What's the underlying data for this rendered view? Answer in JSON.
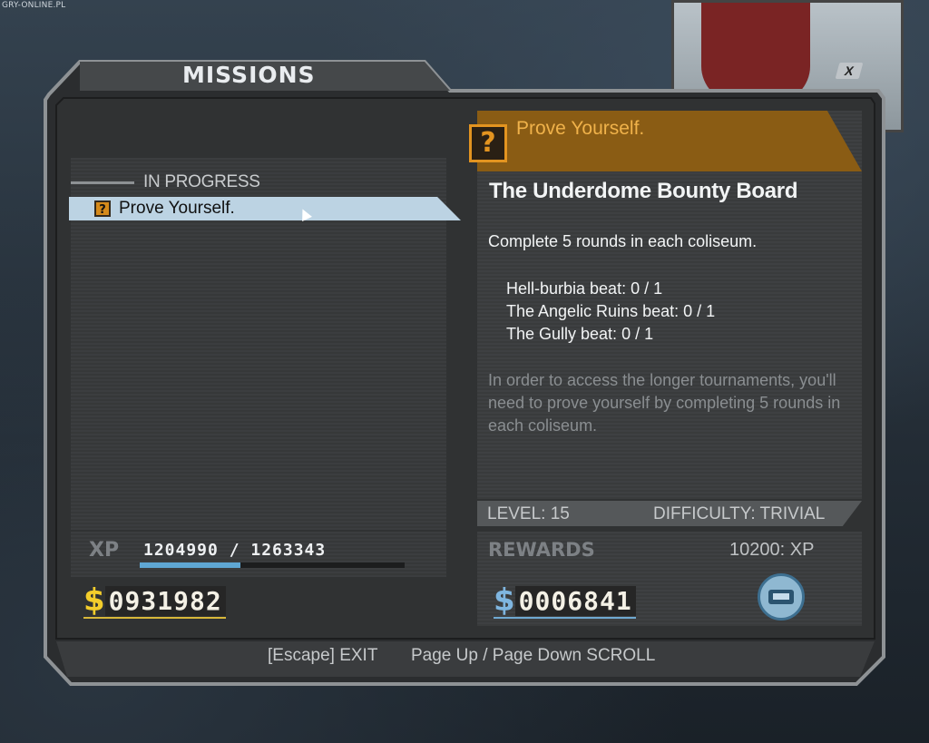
{
  "watermark": "GRY-ONLINE.PL",
  "window": {
    "title": "MISSIONS",
    "close_label": "X"
  },
  "mission_list": {
    "section_label": "IN PROGRESS",
    "items": [
      {
        "label": "Prove Yourself.",
        "icon": "mission-question-icon",
        "selected": true
      }
    ]
  },
  "player": {
    "xp_label": "XP",
    "xp_current": "1204990",
    "xp_separator": " / ",
    "xp_next": "1263343",
    "xp_progress": 0.38,
    "money_symbol": "$",
    "money": "0931982"
  },
  "detail": {
    "icon": "mission-question-icon",
    "title": "Prove Yourself.",
    "giver": "The Underdome Bounty Board",
    "objective": "Complete 5 rounds in each coliseum.",
    "tasks": [
      "Hell-burbia beat: 0 / 1",
      "The Angelic Ruins beat: 0 / 1",
      "The Gully beat: 0 / 1"
    ],
    "description": "In order to access the longer tournaments, you'll need to prove yourself by completing 5 rounds in each coliseum.",
    "level": "LEVEL: 15",
    "difficulty": "DIFFICULTY: TRIVIAL"
  },
  "rewards": {
    "label": "REWARDS",
    "xp": "10200: XP",
    "money_symbol": "$",
    "money": "0006841",
    "item_icon": "reward-item-icon"
  },
  "footer": {
    "escape_hint": "[Escape] EXIT",
    "scroll_hint": "Page Up / Page Down SCROLL"
  },
  "colors": {
    "accent_orange": "#e39420",
    "selected_row": "#bcd3e3",
    "xp_bar": "#5fa7d4",
    "money_gold": "#f3cd2b",
    "money_blue": "#7fb6e0"
  }
}
